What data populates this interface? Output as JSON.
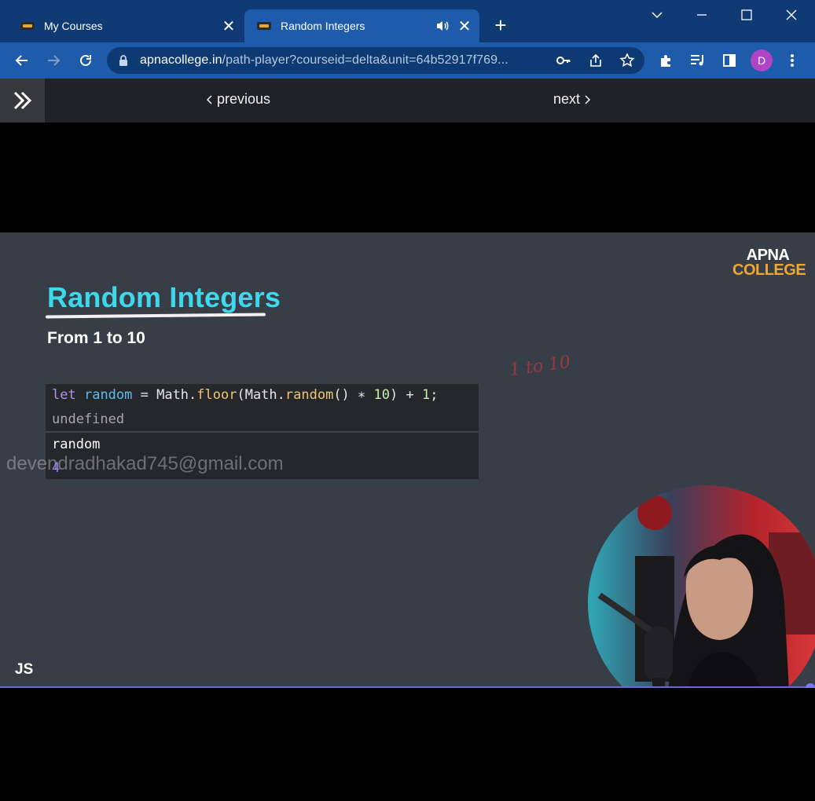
{
  "browser": {
    "tabs": [
      {
        "title": "My Courses",
        "active": false
      },
      {
        "title": "Random Integers",
        "active": true,
        "audio": true
      }
    ],
    "address": {
      "domain": "apnacollege.in",
      "path": "/path-player?courseid=delta&unit=64b52917f769..."
    },
    "profile_initial": "D",
    "colors": {
      "tabstrip": "#0f3a73",
      "active_tab": "#1e5bab",
      "avatar": "#b046c7"
    }
  },
  "nav": {
    "previous_label": "previous",
    "next_label": "next"
  },
  "slide": {
    "title": "Random Integers",
    "subtitle": "From 1 to 10",
    "logo_line1": "APNA",
    "logo_line2": "COLLEGE",
    "annotation": "1 to 10",
    "watermark": "devendradhakad745@gmail.com",
    "footer_label": "JS",
    "console": {
      "input_tokens": [
        {
          "text": "let",
          "cls": "kw"
        },
        {
          "text": " ",
          "cls": "plain"
        },
        {
          "text": "random",
          "cls": "var"
        },
        {
          "text": " = Math.",
          "cls": "plain"
        },
        {
          "text": "floor",
          "cls": "fn"
        },
        {
          "text": "(Math.",
          "cls": "plain"
        },
        {
          "text": "random",
          "cls": "fn"
        },
        {
          "text": "() ∗ ",
          "cls": "plain"
        },
        {
          "text": "10",
          "cls": "num"
        },
        {
          "text": ") + ",
          "cls": "plain"
        },
        {
          "text": "1",
          "cls": "num"
        },
        {
          "text": ";",
          "cls": "plain"
        }
      ],
      "result": "undefined",
      "query": "random",
      "query_result": "4"
    },
    "colors": {
      "background": "#383e47",
      "title": "#3fd8ea",
      "logo_accent": "#f0a730",
      "progress": "#6b68d6"
    }
  },
  "player": {
    "progress_percent": 99
  }
}
